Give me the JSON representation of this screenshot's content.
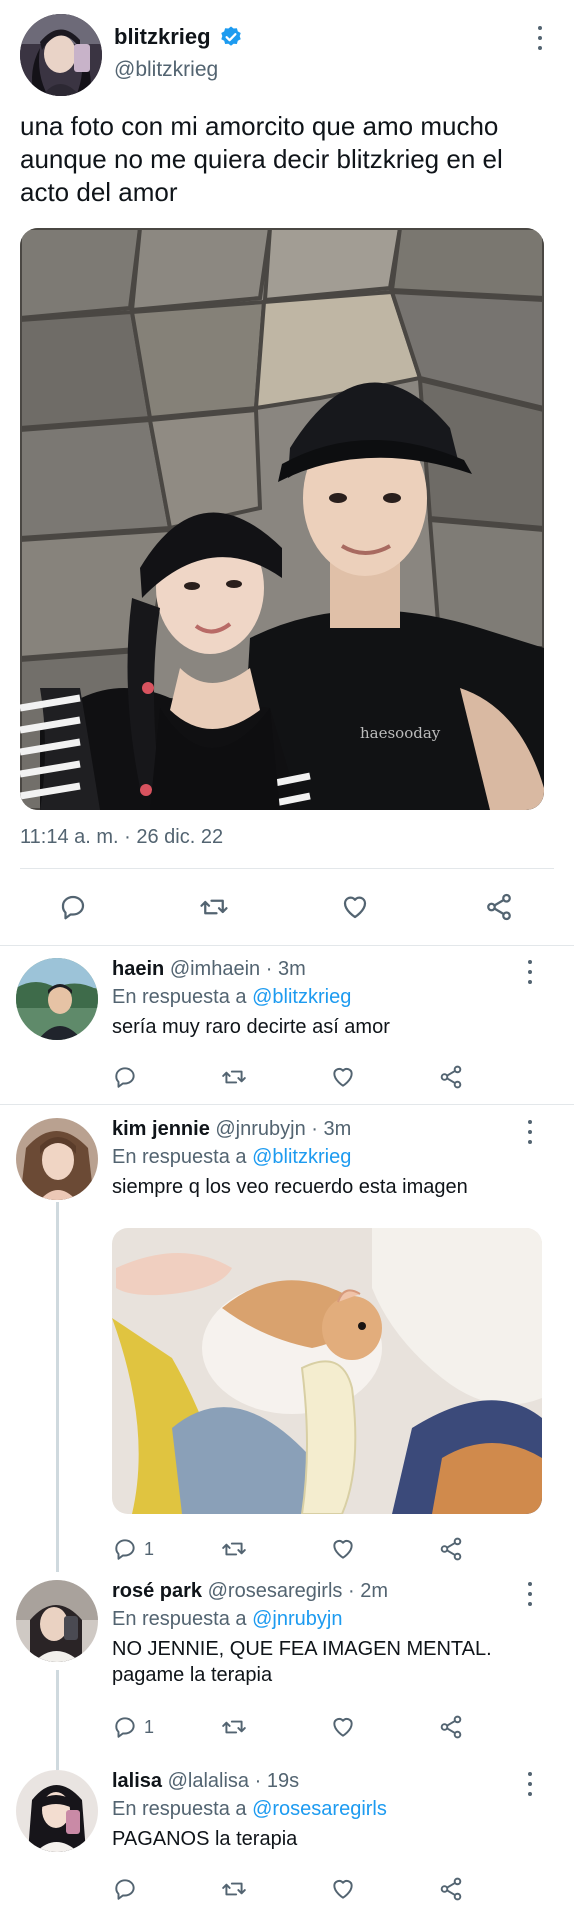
{
  "main_tweet": {
    "display_name": "blitzkrieg",
    "handle": "@blitzkrieg",
    "text": "una foto con mi amorcito que amo mucho aunque no me quiera decir blitzkrieg en el acto del amor",
    "time": "11:14 a. m.",
    "meta_separator": "·",
    "date": "26 dic. 22",
    "photo_watermark": "haesooday"
  },
  "replies": [
    {
      "display_name": "haein",
      "handle": "@imhaein",
      "dot": "·",
      "time": "3m",
      "replying_prefix": "En respuesta a",
      "replying_to": "@blitzkrieg",
      "text": "sería muy raro decirte así amor",
      "reply_count": ""
    },
    {
      "display_name": "kim jennie",
      "handle": "@jnrubyjn",
      "dot": "·",
      "time": "3m",
      "replying_prefix": "En respuesta a",
      "replying_to": "@blitzkrieg",
      "text": "siempre q los veo recuerdo esta imagen",
      "reply_count": "1"
    },
    {
      "display_name": "rosé park",
      "handle": "@rosesaregirls",
      "dot": "·",
      "time": "2m",
      "replying_prefix": "En respuesta a",
      "replying_to": "@jnrubyjn",
      "text": "NO JENNIE, QUE FEA IMAGEN MENTAL. pagame la terapia",
      "reply_count": "1"
    },
    {
      "display_name": "lalisa",
      "handle": "@lalalisa",
      "dot": "·",
      "time": "19s",
      "replying_prefix": "En respuesta a",
      "replying_to": "@rosesaregirls",
      "text": "PAGANOS la terapia",
      "reply_count": ""
    }
  ],
  "icons": {
    "reply": "reply-icon",
    "retweet": "retweet-icon",
    "like": "heart-icon",
    "share": "share-icon",
    "more": "more-icon",
    "verified": "verified-icon"
  },
  "colors": {
    "text": "#0f1419",
    "secondary": "#536471",
    "accent": "#1d9bf0",
    "divider": "#e3e7ea",
    "thread_line": "#cfd9de"
  }
}
